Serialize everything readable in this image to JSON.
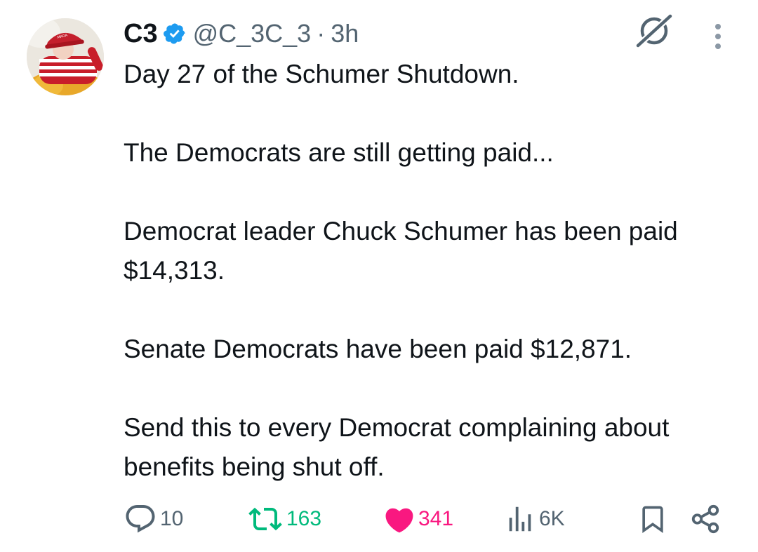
{
  "author": {
    "name": "C3",
    "handle": "@C_3C_3",
    "separator": "·",
    "time": "3h",
    "verified": true
  },
  "tweet": {
    "paragraphs": [
      "Day 27 of the Schumer Shutdown.",
      "The Democrats are still getting paid...",
      "Democrat leader Chuck Schumer has been paid $14,313.",
      "Senate Democrats have been paid $12,871.",
      "Send this to every Democrat complaining about benefits being shut off."
    ]
  },
  "actions": {
    "replies": "10",
    "reposts": "163",
    "likes": "341",
    "views": "6K",
    "liked": true
  },
  "colors": {
    "text": "#0f1419",
    "muted": "#536471",
    "verified": "#1d9bf0",
    "repost": "#00ba7c",
    "like": "#f91880"
  },
  "icons": [
    "grok-icon",
    "more-icon",
    "verified-badge-icon",
    "reply-icon",
    "repost-icon",
    "like-icon",
    "views-icon",
    "bookmark-icon",
    "share-icon"
  ]
}
